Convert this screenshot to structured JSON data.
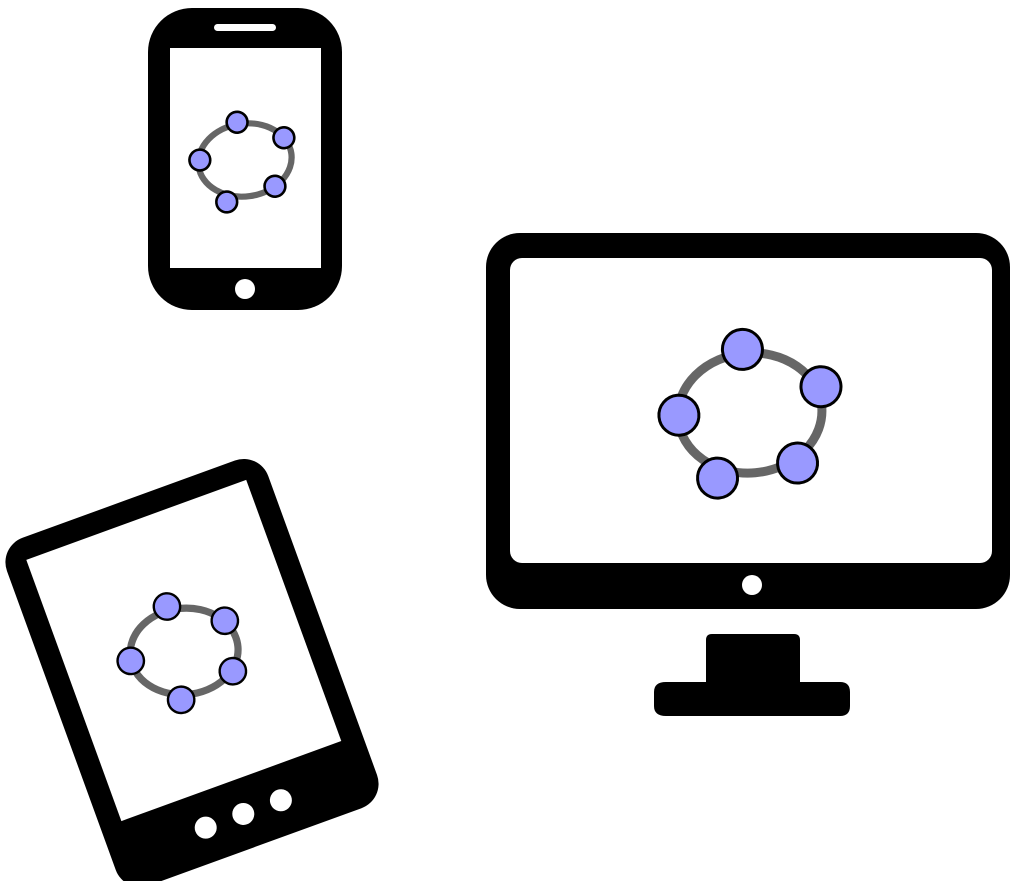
{
  "devices": [
    {
      "name": "smartphone",
      "icon": "smartphone-icon"
    },
    {
      "name": "tablet",
      "icon": "tablet-icon"
    },
    {
      "name": "desktop-monitor",
      "icon": "monitor-icon"
    }
  ],
  "logo": {
    "icon": "geogebra-logo-icon",
    "vertex_count": 5,
    "colors": {
      "device_body": "#000000",
      "screen": "#ffffff",
      "ellipse_stroke": "#666666",
      "vertex_fill": "#9999ff",
      "vertex_stroke": "#000000"
    }
  }
}
